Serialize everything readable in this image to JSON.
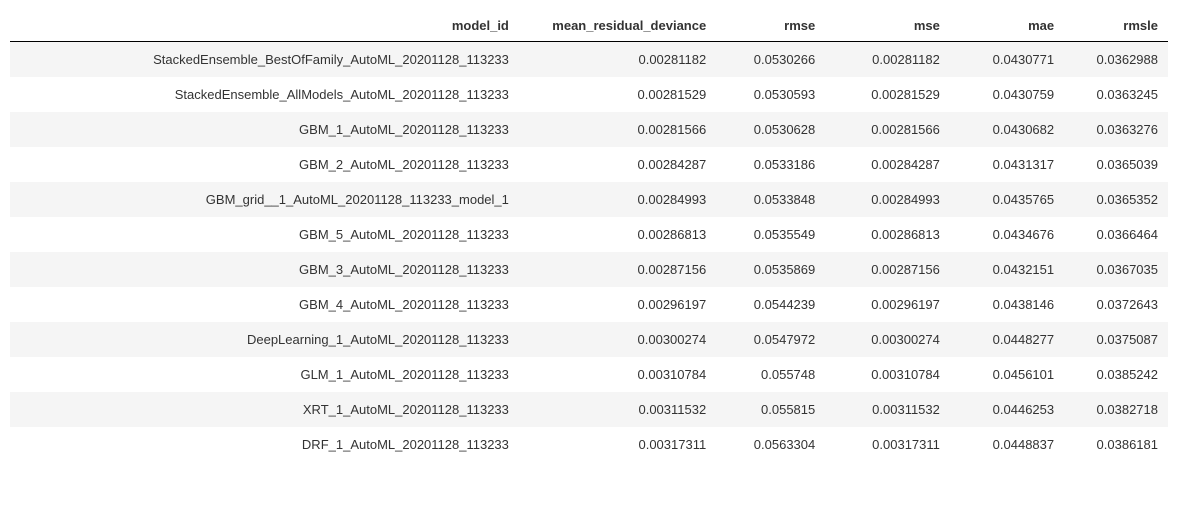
{
  "table": {
    "headers": {
      "model_id": "model_id",
      "mean_residual_deviance": "mean_residual_deviance",
      "rmse": "rmse",
      "mse": "mse",
      "mae": "mae",
      "rmsle": "rmsle"
    },
    "rows": [
      {
        "model_id": "StackedEnsemble_BestOfFamily_AutoML_20201128_113233",
        "mean_residual_deviance": "0.00281182",
        "rmse": "0.0530266",
        "mse": "0.00281182",
        "mae": "0.0430771",
        "rmsle": "0.0362988"
      },
      {
        "model_id": "StackedEnsemble_AllModels_AutoML_20201128_113233",
        "mean_residual_deviance": "0.00281529",
        "rmse": "0.0530593",
        "mse": "0.00281529",
        "mae": "0.0430759",
        "rmsle": "0.0363245"
      },
      {
        "model_id": "GBM_1_AutoML_20201128_113233",
        "mean_residual_deviance": "0.00281566",
        "rmse": "0.0530628",
        "mse": "0.00281566",
        "mae": "0.0430682",
        "rmsle": "0.0363276"
      },
      {
        "model_id": "GBM_2_AutoML_20201128_113233",
        "mean_residual_deviance": "0.00284287",
        "rmse": "0.0533186",
        "mse": "0.00284287",
        "mae": "0.0431317",
        "rmsle": "0.0365039"
      },
      {
        "model_id": "GBM_grid__1_AutoML_20201128_113233_model_1",
        "mean_residual_deviance": "0.00284993",
        "rmse": "0.0533848",
        "mse": "0.00284993",
        "mae": "0.0435765",
        "rmsle": "0.0365352"
      },
      {
        "model_id": "GBM_5_AutoML_20201128_113233",
        "mean_residual_deviance": "0.00286813",
        "rmse": "0.0535549",
        "mse": "0.00286813",
        "mae": "0.0434676",
        "rmsle": "0.0366464"
      },
      {
        "model_id": "GBM_3_AutoML_20201128_113233",
        "mean_residual_deviance": "0.00287156",
        "rmse": "0.0535869",
        "mse": "0.00287156",
        "mae": "0.0432151",
        "rmsle": "0.0367035"
      },
      {
        "model_id": "GBM_4_AutoML_20201128_113233",
        "mean_residual_deviance": "0.00296197",
        "rmse": "0.0544239",
        "mse": "0.00296197",
        "mae": "0.0438146",
        "rmsle": "0.0372643"
      },
      {
        "model_id": "DeepLearning_1_AutoML_20201128_113233",
        "mean_residual_deviance": "0.00300274",
        "rmse": "0.0547972",
        "mse": "0.00300274",
        "mae": "0.0448277",
        "rmsle": "0.0375087"
      },
      {
        "model_id": "GLM_1_AutoML_20201128_113233",
        "mean_residual_deviance": "0.00310784",
        "rmse": "0.055748",
        "mse": "0.00310784",
        "mae": "0.0456101",
        "rmsle": "0.0385242"
      },
      {
        "model_id": "XRT_1_AutoML_20201128_113233",
        "mean_residual_deviance": "0.00311532",
        "rmse": "0.055815",
        "mse": "0.00311532",
        "mae": "0.0446253",
        "rmsle": "0.0382718"
      },
      {
        "model_id": "DRF_1_AutoML_20201128_113233",
        "mean_residual_deviance": "0.00317311",
        "rmse": "0.0563304",
        "mse": "0.00317311",
        "mae": "0.0448837",
        "rmsle": "0.0386181"
      }
    ]
  }
}
